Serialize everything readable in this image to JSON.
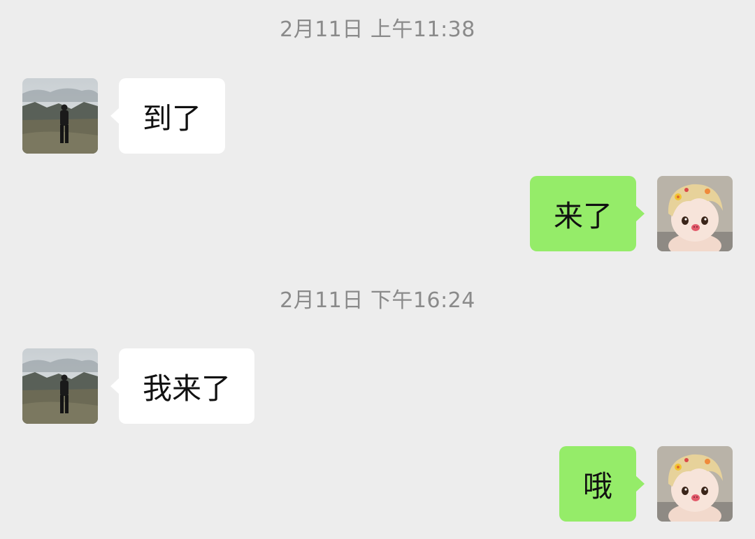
{
  "chat": {
    "timestamps": [
      "2月11日 上午11:38",
      "2月11日 下午16:24"
    ],
    "messages": [
      {
        "sender": "contact",
        "text": "到了"
      },
      {
        "sender": "me",
        "text": "来了"
      },
      {
        "sender": "contact",
        "text": "我来了"
      },
      {
        "sender": "me",
        "text": "哦"
      }
    ]
  },
  "colors": {
    "background": "#ededed",
    "incoming_bubble": "#ffffff",
    "outgoing_bubble": "#95ec69",
    "timestamp_text": "#8a8a8a"
  },
  "icons": {
    "contact_avatar": "landscape-person-avatar-icon",
    "my_avatar": "doll-avatar-icon"
  }
}
